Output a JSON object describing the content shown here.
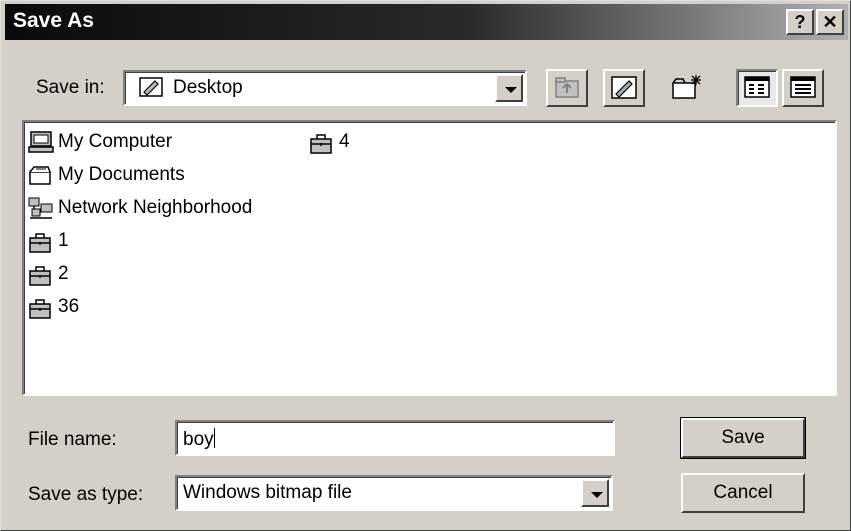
{
  "title": "Save As",
  "title_buttons": {
    "help": "?",
    "close": "✕"
  },
  "save_in": {
    "label": "Save in:",
    "value": "Desktop",
    "icon": "desktop-icon"
  },
  "toolbar": {
    "up_folder_icon": "up-one-level-icon",
    "desktop_icon": "desktop-icon",
    "new_folder_icon": "create-new-folder-icon",
    "list_view_icon": "list-view-icon",
    "details_view_icon": "details-view-icon"
  },
  "files": [
    {
      "name": "My Computer",
      "icon": "my-computer-icon"
    },
    {
      "name": "My Documents",
      "icon": "my-documents-icon"
    },
    {
      "name": "Network Neighborhood",
      "icon": "network-neighborhood-icon"
    },
    {
      "name": "1",
      "icon": "briefcase-icon"
    },
    {
      "name": "2",
      "icon": "briefcase-icon"
    },
    {
      "name": "36",
      "icon": "briefcase-icon"
    },
    {
      "name": "4",
      "icon": "briefcase-icon"
    }
  ],
  "file_name": {
    "label": "File name:",
    "value": "boy"
  },
  "save_as_type": {
    "label": "Save as type:",
    "value": "Windows bitmap file"
  },
  "buttons": {
    "save": "Save",
    "cancel": "Cancel"
  }
}
